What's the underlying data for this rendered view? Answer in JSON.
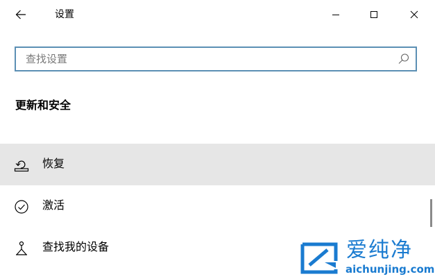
{
  "window": {
    "title": "设置"
  },
  "search": {
    "placeholder": "查找设置",
    "value": ""
  },
  "section": {
    "title": "更新和安全"
  },
  "nav": {
    "items": [
      {
        "label": "恢复",
        "icon": "recovery-icon",
        "selected": true
      },
      {
        "label": "激活",
        "icon": "activation-check-icon",
        "selected": false
      },
      {
        "label": "查找我的设备",
        "icon": "find-my-device-icon",
        "selected": false
      }
    ]
  },
  "watermark": {
    "brand": "爱纯净",
    "url": "aichunjing.com"
  },
  "colors": {
    "accent_border": "#5b8fb4",
    "selected_bg": "#e6e6e6",
    "watermark_blue": "#1a7bd0"
  }
}
